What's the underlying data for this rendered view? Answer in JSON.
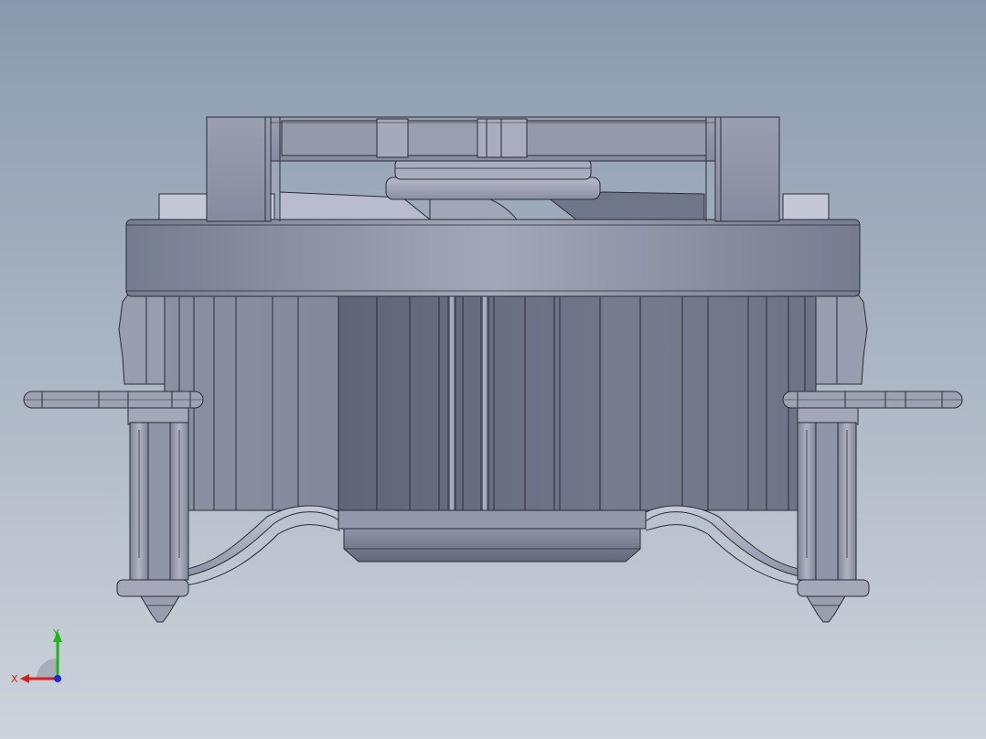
{
  "viewport": {
    "background_top": "#8a9aae",
    "background_bottom": "#cdd3db"
  },
  "model": {
    "part_color": "#8d93a6",
    "edge_color": "#2a2c33"
  },
  "triad": {
    "x_label": "X",
    "y_label": "Y",
    "x_color": "#d42020",
    "y_color": "#18b818",
    "z_color": "#1a2ad8"
  }
}
